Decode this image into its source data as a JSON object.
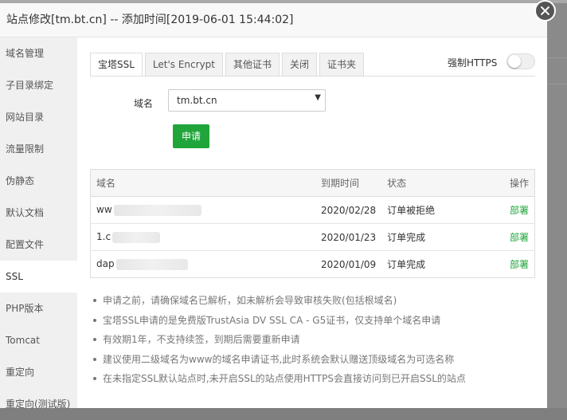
{
  "dialog": {
    "title": "站点修改[tm.bt.cn] -- 添加时间[2019-06-01 15:44:02]"
  },
  "sidebar": {
    "items": [
      {
        "label": "域名管理"
      },
      {
        "label": "子目录绑定"
      },
      {
        "label": "网站目录"
      },
      {
        "label": "流量限制"
      },
      {
        "label": "伪静态"
      },
      {
        "label": "默认文档"
      },
      {
        "label": "配置文件"
      },
      {
        "label": "SSL"
      },
      {
        "label": "PHP版本"
      },
      {
        "label": "Tomcat"
      },
      {
        "label": "重定向"
      },
      {
        "label": "重定向(测试版)"
      }
    ],
    "active": "SSL"
  },
  "tabs": [
    {
      "label": "宝塔SSL"
    },
    {
      "label": "Let's Encrypt"
    },
    {
      "label": "其他证书"
    },
    {
      "label": "关闭"
    },
    {
      "label": "证书夹"
    }
  ],
  "https": {
    "label": "强制HTTPS",
    "enabled": false
  },
  "form": {
    "domain_label": "域名",
    "domain_value": "tm.bt.cn",
    "apply_label": "申请"
  },
  "table": {
    "headers": {
      "domain": "域名",
      "expire": "到期时间",
      "status": "状态",
      "action": "操作"
    },
    "rows": [
      {
        "domain": "ww",
        "expire": "2020/02/28",
        "status": "订单被拒绝",
        "action": "部署"
      },
      {
        "domain": "1.c",
        "expire": "2020/01/23",
        "status": "订单完成",
        "action": "部署"
      },
      {
        "domain": "dap",
        "expire": "2020/01/09",
        "status": "订单完成",
        "action": "部署"
      }
    ]
  },
  "tips": [
    "申请之前，请确保域名已解析，如未解析会导致审核失败(包括根域名)",
    "宝塔SSL申请的是免费版TrustAsia DV SSL CA - G5证书，仅支持单个域名申请",
    "有效期1年，不支持续签，到期后需要重新申请",
    "建议使用二级域名为www的域名申请证书,此时系统会默认赠送顶级域名为可选名称",
    "在未指定SSL默认站点时,未开启SSL的站点使用HTTPS会直接访问到已开启SSL的站点"
  ],
  "colors": {
    "accent": "#20a53a",
    "overlay": "#7f7f7f"
  }
}
